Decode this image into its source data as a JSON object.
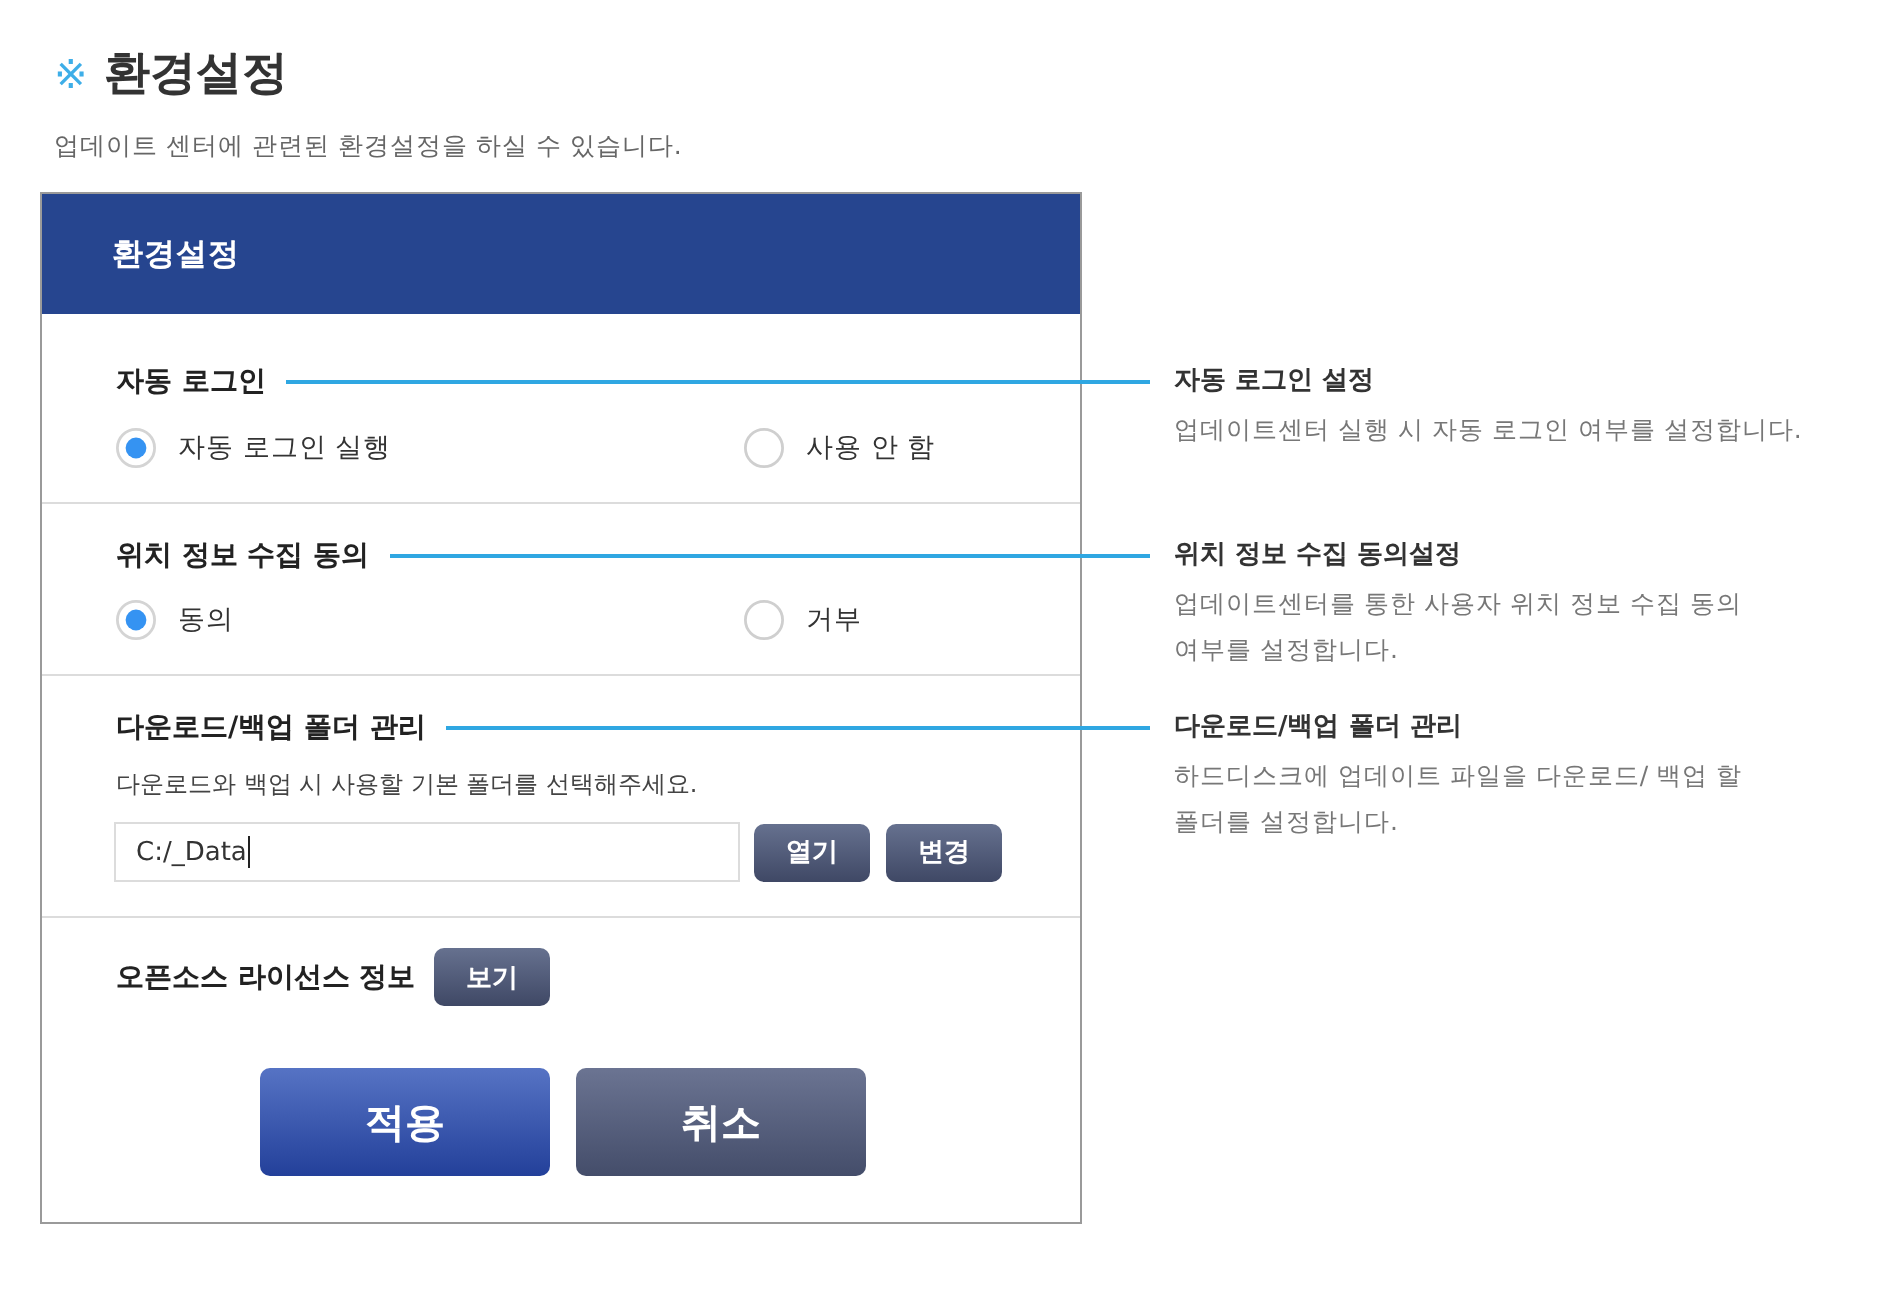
{
  "page": {
    "mark": "※",
    "title": "환경설정",
    "subtitle": "업데이트 센터에 관련된 환경설정을 하실 수 있습니다."
  },
  "dialog": {
    "title": "환경설정",
    "sections": [
      {
        "kind": "radio",
        "label": "자동 로그인",
        "options": [
          {
            "label": "자동 로그인 실행",
            "selected": true
          },
          {
            "label": "사용 안 함",
            "selected": false
          }
        ],
        "annotation": {
          "title": "자동 로그인 설정",
          "lines": [
            "업데이트센터 실행 시 자동 로그인 여부를 설정합니다."
          ]
        }
      },
      {
        "kind": "radio",
        "label": "위치 정보 수집 동의",
        "options": [
          {
            "label": "동의",
            "selected": true
          },
          {
            "label": "거부",
            "selected": false
          }
        ],
        "annotation": {
          "title": "위치 정보 수집 동의설정",
          "lines": [
            "업데이트센터를 통한 사용자 위치 정보 수집 동의",
            "여부를 설정합니다."
          ]
        }
      },
      {
        "kind": "folder",
        "label": "다운로드/백업 폴더 관리",
        "description": "다운로드와 백업 시 사용할 기본 폴더를 선택해주세요.",
        "path": {
          "value": "C:/_Data",
          "focused": true
        },
        "buttons": [
          "열기",
          "변경"
        ],
        "annotation": {
          "title": "다운로드/백업 폴더 관리",
          "lines": [
            "하드디스크에 업데이트 파일을 다운로드/ 백업 할",
            "폴더를 설정합니다."
          ]
        }
      },
      {
        "kind": "license",
        "label": "오픈소스 라이선스 정보",
        "button": "보기"
      }
    ],
    "buttons": [
      {
        "label": "적용",
        "kind": "primary"
      },
      {
        "label": "취소",
        "kind": "secondary"
      }
    ]
  }
}
